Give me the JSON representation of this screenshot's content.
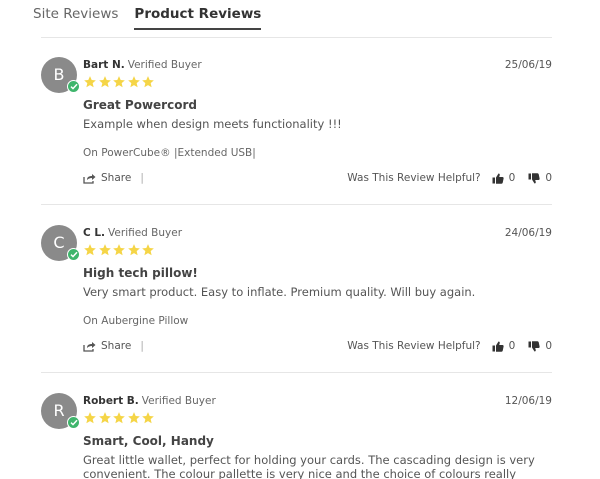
{
  "tabs": [
    {
      "label": "Site Reviews",
      "active": false
    },
    {
      "label": "Product Reviews",
      "active": true
    }
  ],
  "helpful_label": "Was This Review Helpful?",
  "share_label": "Share",
  "separator": "|",
  "colors": {
    "star": "#f5d547",
    "avatar": "#8a8a8a",
    "verified_badge": "#3fb56c"
  },
  "reviews": [
    {
      "initial": "B",
      "author": "Bart N.",
      "verified": "Verified Buyer",
      "date": "25/06/19",
      "rating": 5,
      "title": "Great Powercord",
      "body": "Example when design meets functionality !!!",
      "product": "On PowerCube® |Extended USB|",
      "helpful_up": "0",
      "helpful_down": "0"
    },
    {
      "initial": "C",
      "author": "C L.",
      "verified": "Verified Buyer",
      "date": "24/06/19",
      "rating": 5,
      "title": "High tech pillow!",
      "body": "Very smart product. Easy to inflate. Premium quality. Will buy again.",
      "product": "On Aubergine Pillow",
      "helpful_up": "0",
      "helpful_down": "0"
    },
    {
      "initial": "R",
      "author": "Robert B.",
      "verified": "Verified Buyer",
      "date": "12/06/19",
      "rating": 5,
      "title": "Smart, Cool, Handy",
      "body": "Great little wallet, perfect for holding your cards. The cascading design is very convenient. The colour pallette is very nice and the choice of colours really"
    }
  ]
}
